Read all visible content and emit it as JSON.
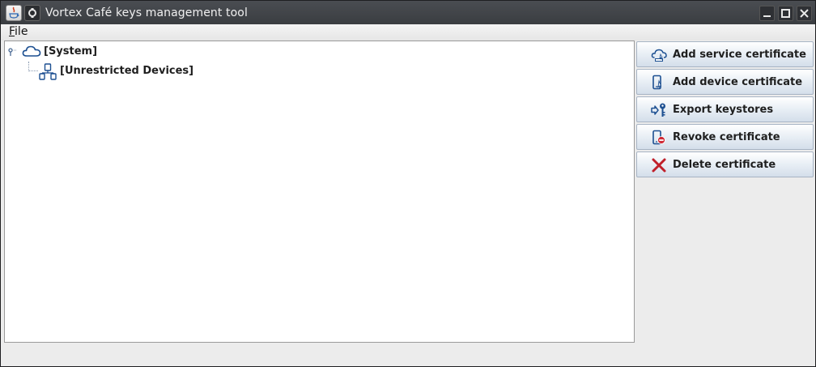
{
  "window": {
    "title": "Vortex Café keys management tool",
    "icons": [
      "java-app-icon",
      "window-menu-icon"
    ],
    "controls": [
      "minimize-icon",
      "maximize-icon",
      "close-icon"
    ]
  },
  "menubar": {
    "file_mnemonic": "F",
    "file_rest": "ile"
  },
  "tree": {
    "root": {
      "label": "[System]",
      "icon": "cloud-icon",
      "expanded": true
    },
    "children": [
      {
        "label": "[Unrestricted Devices]",
        "icon": "devices-network-icon"
      }
    ]
  },
  "actions": [
    {
      "label": "Add service certificate",
      "icon": "cloud-add-icon"
    },
    {
      "label": "Add device certificate",
      "icon": "device-add-icon"
    },
    {
      "label": "Export keystores",
      "icon": "export-key-icon"
    },
    {
      "label": "Revoke certificate",
      "icon": "device-revoke-icon"
    },
    {
      "label": "Delete certificate",
      "icon": "delete-x-icon"
    }
  ],
  "colors": {
    "accent_blue": "#1c4f91",
    "delete_red": "#c0202a",
    "titlebar": "#3e4145"
  }
}
